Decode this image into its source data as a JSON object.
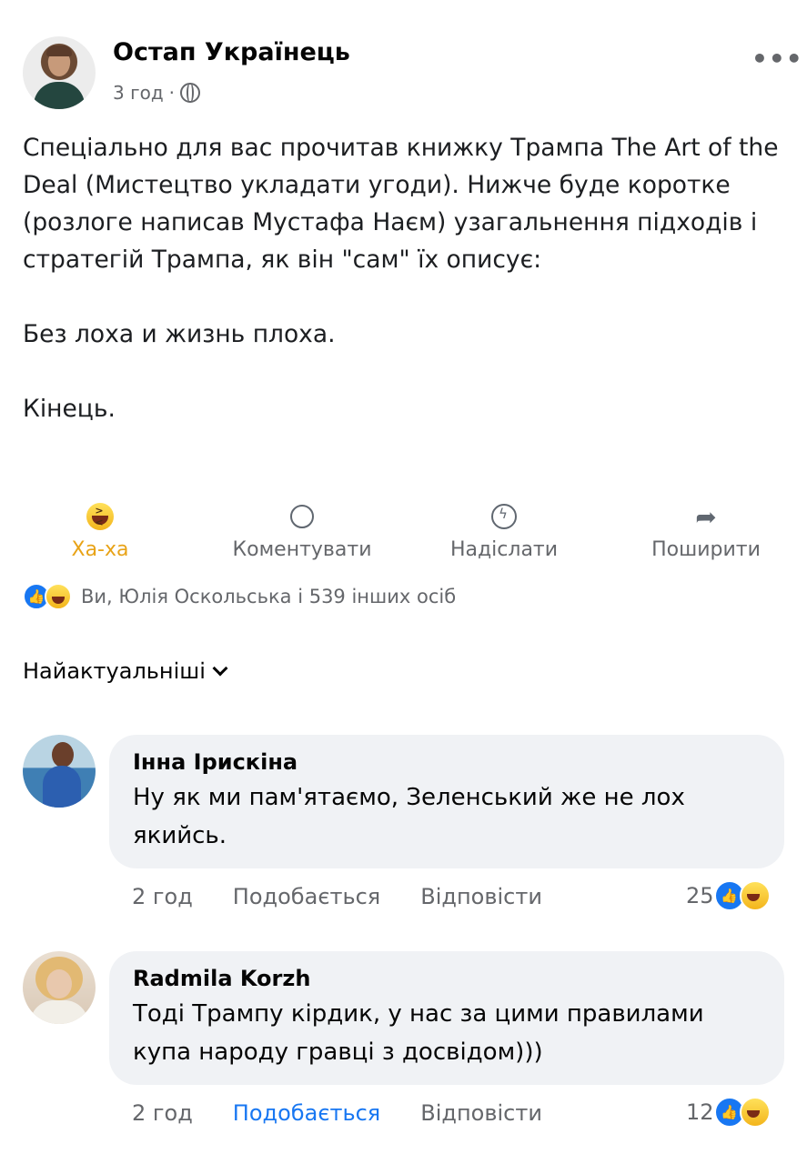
{
  "post": {
    "author": "Остап Українець",
    "time": "3 год",
    "separator": "·",
    "paragraphs": [
      "Спеціально для вас прочитав книжку Трампа The Art of the Deal (Мистецтво укладати угоди). Нижче буде коротке (розлоге написав Мустафа Наєм) узагальнення підходів і стратегій Трампа, як він \"сам\" їх описує:",
      "Без лоха и жизнь плоха.",
      "Кінець."
    ],
    "more_icon": "•••"
  },
  "actions": {
    "haha": "Ха-ха",
    "comment": "Коментувати",
    "send": "Надіслати",
    "share": "Поширити"
  },
  "reactions": {
    "summary": "Ви, Юлія Оскольська і 539 інших осіб"
  },
  "sort": {
    "label": "Найактуальніші"
  },
  "comments": [
    {
      "name": "Інна Ірискіна",
      "text": "Ну як ми пам'ятаємо, Зеленський же не лох якийсь.",
      "time": "2 год",
      "like": "Подобається",
      "reply": "Відповісти",
      "count": "25",
      "liked": false
    },
    {
      "name": "Radmila Korzh",
      "text": "Тоді Трампу кірдик, у нас за цими правилами купа народу гравці з досвідом)))",
      "time": "2 год",
      "like": "Подобається",
      "reply": "Відповісти",
      "count": "12",
      "liked": true
    }
  ],
  "colors": {
    "accent_blue": "#1877f2",
    "haha_gold": "#e8a317",
    "secondary_text": "#65676b",
    "comment_bg": "#f0f2f5"
  }
}
